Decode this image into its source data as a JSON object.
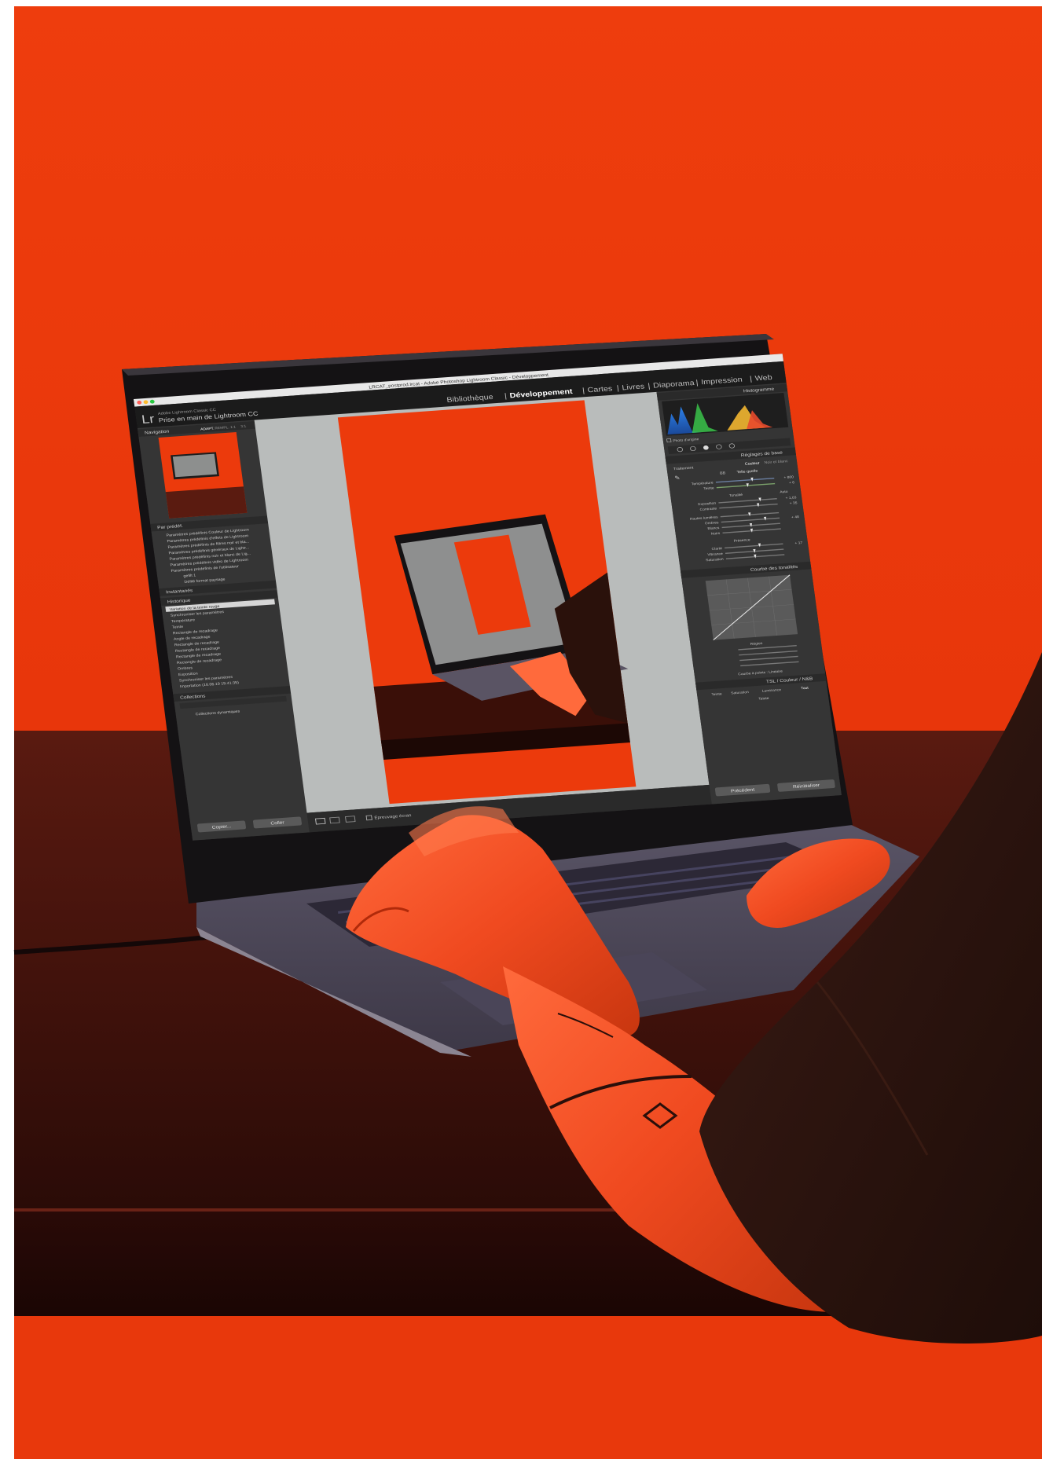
{
  "scene": {
    "colors": {
      "backdrop": "#ea3a0c",
      "desk": "#4a140c",
      "laptop_body": "#6e6c78",
      "screen_bg": "#2b2b2b",
      "canvas_bg": "#b9bcbb"
    }
  },
  "lightroom": {
    "window_title": "LRCAT_postprod.lrcat - Adobe Photoshop Lightroom Classic - Développement",
    "identity_small": "Adobe Lightroom Classic CC",
    "identity_name": "Prise en main de Lightroom CC",
    "modules": [
      "Bibliothèque",
      "Développement",
      "Cartes",
      "Livres",
      "Diaporama",
      "Impression",
      "Web"
    ],
    "active_module": "Développement",
    "left_panel": {
      "navigator_title": "Navigation",
      "navigator_zoom": [
        "ADAPT.",
        "REMPL.",
        "1:1",
        "3:1"
      ],
      "presets_title": "Par prédéf.",
      "presets": [
        "Paramètres prédéfinis Couleur de Lightroom",
        "Paramètres prédéfinis d'effets de Lightroom",
        "Paramètres prédéfinis de filtres noir et bla...",
        "Paramètres prédéfinis généraux de Lightr...",
        "Paramètres prédéfinis noir et blanc de Lig...",
        "Paramètres prédéfinis vidéo de Lightroom",
        "Paramètres prédéfinis de l'utilisateur",
        "gefilt 1",
        "Défilé format paysage"
      ],
      "snapshots_title": "Instantanés",
      "history_title": "Historique",
      "history": [
        "Variation de la teinte rouge",
        "Synchroniser les paramètres",
        "Température",
        "Teinte",
        "Rectangle de recadrage",
        "Angle de recadrage",
        "Rectangle de recadrage",
        "Rectangle de recadrage",
        "Rectangle de recadrage",
        "Rectangle de recadrage",
        "Ombres",
        "Exposition",
        "Synchroniser les paramètres",
        "Importation (18.06.19 15:41:35)"
      ],
      "collections_title": "Collections",
      "collections_item": "Collections dynamiques",
      "copy_button": "Copier...",
      "paste_button": "Coller"
    },
    "toolbar": {
      "softproof_label": "Épreuvage écran"
    },
    "right_panel": {
      "histogram_title": "Histogramme",
      "photo_label": "Photo d'origine",
      "basic_title": "Réglages de base",
      "treatment_label": "Traitement",
      "color_option": "Couleur",
      "bw_option": "Noir et blanc",
      "wb_label": "BB",
      "wb_value": "Telle quelle",
      "temperature_label": "Température",
      "temperature_value": "+ 800",
      "tint_label": "Teinte",
      "tint_value": "+ 6",
      "tone_label": "Tonalité",
      "auto_label": "Auto",
      "exposure_label": "Exposition",
      "exposure_value": "+ 1,03",
      "contrast_label": "Contraste",
      "contrast_value": "+ 35",
      "highlights_label": "Hautes lumières",
      "shadows_label": "Ombres",
      "shadows_value": "+ 48",
      "whites_label": "Blancs",
      "blacks_label": "Noirs",
      "presence_label": "Présence",
      "clarity_label": "Clarté",
      "clarity_value": "+ 17",
      "vibrance_label": "Vibrance",
      "saturation_label": "Saturation",
      "curve_title": "Courbe des tonalités",
      "region_label": "Région",
      "curve_channel": "Courbe à points : Linéaire",
      "hsl_title": "TSL / Couleur / N&B",
      "hsl_tabs": [
        "Teinte",
        "Saturation",
        "Luminance",
        "Tout"
      ],
      "hsl_sub": "Teinte",
      "previous_button": "Précédent",
      "reset_button": "Réinitialiser"
    }
  }
}
